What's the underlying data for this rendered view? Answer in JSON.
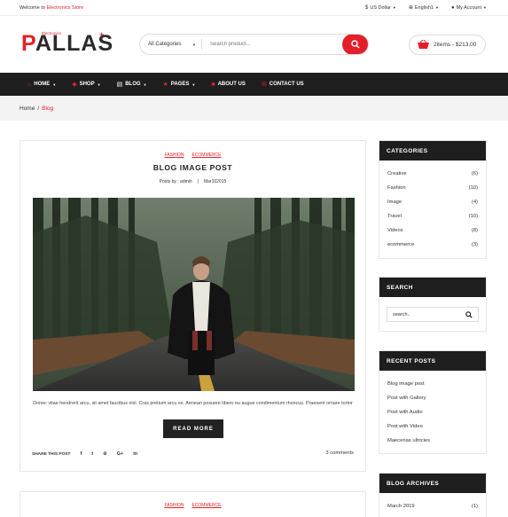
{
  "topbar": {
    "welcome": "Welcome to",
    "store": "Electronics Store",
    "currency": "US Dollar",
    "language": "English1",
    "account": "My Account"
  },
  "logo": {
    "text": "ALLAS",
    "first": "P",
    "sub": "Electronics"
  },
  "search": {
    "category": "All Categories",
    "placeholder": "Search product..."
  },
  "cart": {
    "summary": "2items - $213.00"
  },
  "nav": [
    {
      "label": "HOME",
      "caret": true
    },
    {
      "label": "SHOP",
      "caret": true
    },
    {
      "label": "BLOG",
      "caret": true
    },
    {
      "label": "PAGES",
      "caret": true
    },
    {
      "label": "ABOUT US",
      "caret": false
    },
    {
      "label": "CONTACT US",
      "caret": false
    }
  ],
  "breadcrumb": {
    "home": "Home",
    "sep": "/",
    "current": "Blog"
  },
  "post": {
    "tags": [
      "FASHION",
      "ECOMMERCE"
    ],
    "title": "BLOG IMAGE POST",
    "author": "Posts by : admin",
    "sep": "|",
    "date": "Mar102015",
    "excerpt": "Donec vitae hendrerit arcu, sit amet faucibus nisl. Cras pretium arcu ex. Aenean posuere libero eu augue condimentum rhoncus. Praesent ornare tortor",
    "read_more": "READ MORE",
    "share_label": "SHARE THIS POST",
    "comments": "3 comments"
  },
  "post2": {
    "tags": [
      "FASHION",
      "ECOMMERCE"
    ]
  },
  "sidebar": {
    "categories": {
      "title": "CATEGORIES",
      "items": [
        {
          "label": "Creative",
          "count": "(6)"
        },
        {
          "label": "Fashion",
          "count": "(10)"
        },
        {
          "label": "Image",
          "count": "(4)"
        },
        {
          "label": "Travel",
          "count": "(10)"
        },
        {
          "label": "Videos",
          "count": "(8)"
        },
        {
          "label": "ecommerce",
          "count": "(3)"
        }
      ]
    },
    "search": {
      "title": "SEARCH",
      "placeholder": "search.."
    },
    "recent": {
      "title": "RECENT POSTS",
      "items": [
        "Blog image post",
        "Post with Gallery",
        "Post with Audio",
        "Post with Video",
        "Maecenas ultricies"
      ]
    },
    "archives": {
      "title": "BLOG ARCHIVES",
      "items": [
        {
          "label": "March 2019",
          "count": "(1)"
        }
      ]
    }
  },
  "colors": {
    "accent": "#e3202a",
    "dark": "#1e1e1e"
  }
}
